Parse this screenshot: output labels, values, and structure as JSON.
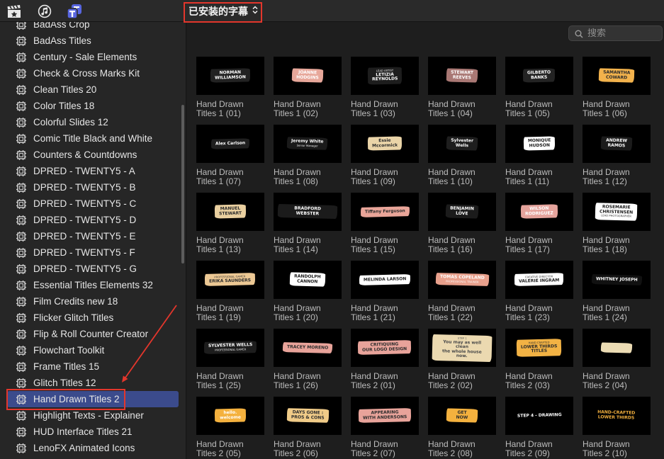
{
  "toolbar": {
    "icons": {
      "media": "clapperboard-star-icon",
      "audio": "music-icon",
      "titles": "titles-generators-icon"
    },
    "titles_icon_color": "#5866e0",
    "selector": {
      "label": "已安装的字幕",
      "icon": "up-down-chevron-icon"
    }
  },
  "search": {
    "placeholder": "搜索",
    "icon": "search-icon"
  },
  "sidebar": {
    "item_icon": "title-generator-icon",
    "selected_index": 23,
    "selected_color": "#3b4b8c",
    "items": [
      "BadAss Crop",
      "BadAss Titles",
      "Century - Sale Elements",
      "Check & Cross Marks Kit",
      "Clean Titles 20",
      "Color Titles 18",
      "Colorful Slides 12",
      "Comic Title Black and White",
      "Counters & Countdowns",
      "DPRED - TWENTY5 - A",
      "DPRED - TWENTY5 - B",
      "DPRED - TWENTY5 - C",
      "DPRED - TWENTY5 - D",
      "DPRED - TWENTY5 - E",
      "DPRED - TWENTY5 - F",
      "DPRED - TWENTY5 - G",
      "Essential Titles Elements 32",
      "Film Credits new 18",
      "Flicker Glitch Titles",
      "Flip & Roll Counter Creator",
      "Flowchart Toolkit",
      "Frame Titles 15",
      "Glitch Titles 12",
      "Hand Drawn Titles 2",
      "Highlight Texts - Explainer",
      "HUD Interface Titles 21",
      "LenoFX Animated Icons"
    ]
  },
  "grid": {
    "thumb_bg": "#000000",
    "items": [
      {
        "name": "Hand Drawn Titles 1 (01)",
        "brush": "#222222",
        "ink": "#ffffff",
        "lines": [
          "NORMAN",
          "WILLIAMSON"
        ]
      },
      {
        "name": "Hand Drawn Titles 1 (02)",
        "brush": "#e7a79a",
        "ink": "#ffffff",
        "lines": [
          "JOANNE",
          "HODGINS"
        ]
      },
      {
        "name": "Hand Drawn Titles 1 (03)",
        "brush": "#1d1d1d",
        "ink": "#ffffff",
        "kicker": "LEAD ARTIST",
        "lines": [
          "LETIZIA",
          "REYNOLDS"
        ]
      },
      {
        "name": "Hand Drawn Titles 1 (04)",
        "brush": "#a97874",
        "ink": "#ffffff",
        "lines": [
          "STEWART",
          "REEVES"
        ]
      },
      {
        "name": "Hand Drawn Titles 1 (05)",
        "brush": "#232323",
        "ink": "#ffffff",
        "lines": [
          "GILBERTO",
          "BANKS"
        ]
      },
      {
        "name": "Hand Drawn Titles 1 (06)",
        "brush": "#f2b24c",
        "ink": "#2b2b2b",
        "lines": [
          "SAMANTHA",
          "COWARD"
        ]
      },
      {
        "name": "Hand Drawn Titles 1 (07)",
        "brush": "#1f1f1f",
        "ink": "#ffffff",
        "lines": [
          "Alex Carlson"
        ]
      },
      {
        "name": "Hand Drawn Titles 1 (08)",
        "brush": "#1a1a1a",
        "ink": "#ffffff",
        "lines": [
          "Jeremy White"
        ],
        "sub": "Senior Manager"
      },
      {
        "name": "Hand Drawn Titles 1 (09)",
        "brush": "#ead4a8",
        "ink": "#2b2b2b",
        "lines": [
          "Essie",
          "Mccormick"
        ]
      },
      {
        "name": "Hand Drawn Titles 1 (10)",
        "brush": "#1e1e1e",
        "ink": "#ffffff",
        "lines": [
          "Sylvester",
          "Wells"
        ]
      },
      {
        "name": "Hand Drawn Titles 1 (11)",
        "brush": "#ffffff",
        "ink": "#1a1a1a",
        "lines": [
          "MONIQUE",
          "HUDSON"
        ]
      },
      {
        "name": "Hand Drawn Titles 1 (12)",
        "brush": "#1b1b1b",
        "ink": "#ffffff",
        "lines": [
          "ANDREW",
          "RAMOS"
        ]
      },
      {
        "name": "Hand Drawn Titles 1 (13)",
        "brush": "#ead0a0",
        "ink": "#2b2b2b",
        "lines": [
          "MANUEL",
          "STEWART"
        ]
      },
      {
        "name": "Hand Drawn Titles 1 (14)",
        "brush": "#1b1b1b",
        "ink": "#ffffff",
        "lines": [
          "BRADFORD WEBSTER"
        ]
      },
      {
        "name": "Hand Drawn Titles 1 (15)",
        "brush": "#e9a599",
        "ink": "#2b2b2b",
        "lines": [
          "Tiffany Ferguson"
        ]
      },
      {
        "name": "Hand Drawn Titles 1 (16)",
        "brush": "#1b1b1b",
        "ink": "#ffffff",
        "lines": [
          "BENJAMIN",
          "LOVE"
        ]
      },
      {
        "name": "Hand Drawn Titles 1 (17)",
        "brush": "#e5a39c",
        "ink": "#ffffff",
        "lines": [
          "WILSON",
          "RODRIGUEZ"
        ]
      },
      {
        "name": "Hand Drawn Titles 1 (18)",
        "brush": "#ffffff",
        "ink": "#1a1a1a",
        "lines": [
          "ROSEMARIE",
          "CHRISTENSEN"
        ],
        "sub": "LEAD PHOTOGRAPHER"
      },
      {
        "name": "Hand Drawn Titles 1 (19)",
        "brush": "#ecc894",
        "ink": "#2b2b2b",
        "kicker": "PROFESSIONAL GAMER",
        "lines": [
          "ERIKA SAUNDERS"
        ]
      },
      {
        "name": "Hand Drawn Titles 1 (20)",
        "brush": "#ffffff",
        "ink": "#1a1a1a",
        "lines": [
          "RANDOLPH",
          "CANNON"
        ]
      },
      {
        "name": "Hand Drawn Titles 1 (21)",
        "brush": "#ffffff",
        "ink": "#1a1a1a",
        "lines": [
          "MELINDA LARSON"
        ]
      },
      {
        "name": "Hand Drawn Titles 1 (22)",
        "brush": "#e8a08c",
        "ink": "#ffffff",
        "lines": [
          "TOMAS COPELAND"
        ],
        "sub": "PROFESSIONAL TRAINER"
      },
      {
        "name": "Hand Drawn Titles 1 (23)",
        "brush": "#ffffff",
        "ink": "#1a1a1a",
        "kicker": "CREATIVE DIRECTOR",
        "lines": [
          "VALERIE INGRAM"
        ]
      },
      {
        "name": "Hand Drawn Titles 1 (24)",
        "brush": "#111111",
        "ink": "#ffffff",
        "lines": [
          "WHITNEY JOSEPH"
        ]
      },
      {
        "name": "Hand Drawn Titles 1 (25)",
        "brush": "#1d1d1d",
        "ink": "#ffffff",
        "lines": [
          "SYLVESTER WELLS"
        ],
        "sub": "PROFESSIONAL GAMER"
      },
      {
        "name": "Hand Drawn Titles 1 (26)",
        "brush": "#e8a39a",
        "ink": "#2b2b2b",
        "lines": [
          "TRACEY MORENO"
        ]
      },
      {
        "name": "Hand Drawn Titles 2 (01)",
        "brush": "#e8a39a",
        "ink": "#2b2b2b",
        "lines": [
          "CRITIQUING",
          "OUR LOGO DESIGN"
        ]
      },
      {
        "name": "Hand Drawn Titles 2 (02)",
        "brush": "#ebd9b0",
        "ink": "#4a4a4a",
        "kicker": "STEP 1",
        "lines": [
          "You may as well clean",
          "the whole house now."
        ]
      },
      {
        "name": "Hand Drawn Titles 2 (03)",
        "brush": "#f2b244",
        "ink": "#2b2b2b",
        "kicker": "HAND CRAFTED",
        "lines": [
          "LOWER THIRDS",
          "TITLES"
        ]
      },
      {
        "name": "Hand Drawn Titles 2 (04)",
        "brush": "#ecdcb4",
        "ink": "#6b6b6b",
        "lines": []
      },
      {
        "name": "Hand Drawn Titles 2 (05)",
        "brush": "#f4b13e",
        "ink": "#ffffff",
        "lines": [
          "hello.",
          "welcome"
        ]
      },
      {
        "name": "Hand Drawn Titles 2 (06)",
        "brush": "#f0cb88",
        "ink": "#2b2b2b",
        "lines": [
          "DAYS GONE :",
          "PROS & CONS"
        ]
      },
      {
        "name": "Hand Drawn Titles 2 (07)",
        "brush": "#e8a39a",
        "ink": "#2b2b2b",
        "lines": [
          "APPEARING",
          "WITH ANDERSONS"
        ]
      },
      {
        "name": "Hand Drawn Titles 2 (08)",
        "brush": "#f4b13e",
        "ink": "#2b2b2b",
        "lines": [
          "GET",
          "NOW"
        ]
      },
      {
        "name": "Hand Drawn Titles 2 (09)",
        "brush": "#000000",
        "ink": "#ffffff",
        "lines": [
          "STEP 4 - DRAWING"
        ]
      },
      {
        "name": "Hand Drawn Titles 2 (10)",
        "brush": "#000000",
        "ink": "#f4b13e",
        "lines": [
          "HAND-CRAFTED",
          "LOWER THIRDS"
        ]
      }
    ]
  },
  "annotations": {
    "color": "#e3362c"
  }
}
